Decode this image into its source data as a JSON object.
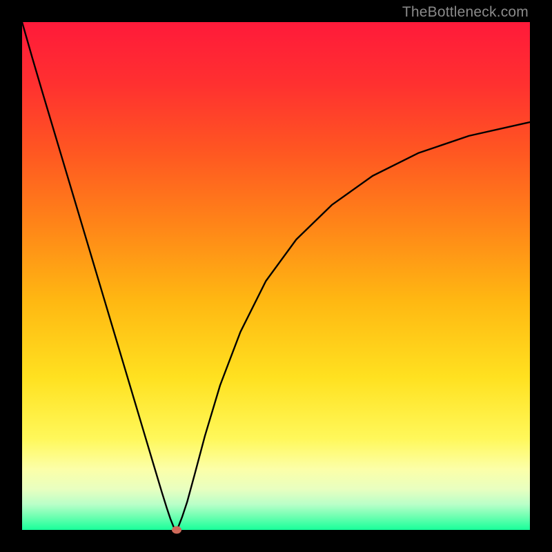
{
  "watermark": "TheBottleneck.com",
  "gradient": {
    "stops": [
      {
        "offset": 0.0,
        "color": "#ff1a3a"
      },
      {
        "offset": 0.12,
        "color": "#ff3030"
      },
      {
        "offset": 0.25,
        "color": "#ff5522"
      },
      {
        "offset": 0.4,
        "color": "#ff8518"
      },
      {
        "offset": 0.55,
        "color": "#ffb812"
      },
      {
        "offset": 0.7,
        "color": "#ffe120"
      },
      {
        "offset": 0.82,
        "color": "#fff85a"
      },
      {
        "offset": 0.88,
        "color": "#fcffa8"
      },
      {
        "offset": 0.92,
        "color": "#e8ffc0"
      },
      {
        "offset": 0.95,
        "color": "#b8ffc8"
      },
      {
        "offset": 0.975,
        "color": "#6affb0"
      },
      {
        "offset": 1.0,
        "color": "#18ff9a"
      }
    ]
  },
  "chart_data": {
    "type": "line",
    "title": "",
    "xlabel": "",
    "ylabel": "",
    "xlim": [
      0,
      1
    ],
    "ylim": [
      0,
      1
    ],
    "x": [
      0.0,
      0.02,
      0.04,
      0.06,
      0.08,
      0.1,
      0.12,
      0.14,
      0.16,
      0.18,
      0.2,
      0.22,
      0.24,
      0.26,
      0.275,
      0.285,
      0.292,
      0.298,
      0.302,
      0.308,
      0.315,
      0.325,
      0.34,
      0.36,
      0.39,
      0.43,
      0.48,
      0.54,
      0.61,
      0.69,
      0.78,
      0.88,
      1.0
    ],
    "values": [
      1.0,
      0.93,
      0.862,
      0.795,
      0.728,
      0.661,
      0.594,
      0.527,
      0.46,
      0.393,
      0.326,
      0.259,
      0.192,
      0.125,
      0.075,
      0.043,
      0.022,
      0.007,
      0.0,
      0.007,
      0.025,
      0.055,
      0.11,
      0.185,
      0.285,
      0.39,
      0.49,
      0.572,
      0.64,
      0.697,
      0.742,
      0.776,
      0.803
    ],
    "marker": {
      "x": 0.305,
      "y": 0.0,
      "color": "#cf6a5a"
    }
  }
}
